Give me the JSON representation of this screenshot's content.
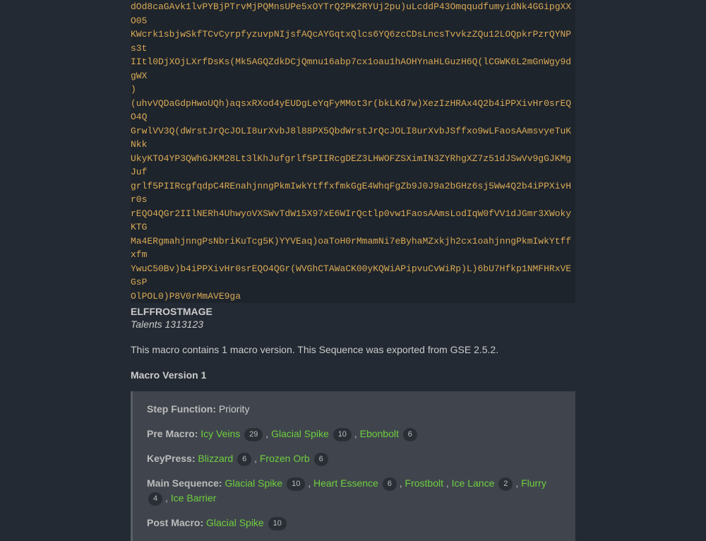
{
  "encoded_lines": [
    "dOd8caGAvk1lvPYBjPTrvMjPQMnsUPe5xOYTrQ2PK2RYUj2pu)uLcddP43OmqqudfumyidNk4GGipgXXO05",
    "KWcrk1sbjwSkfTCvCyrpfyzuvpNIjsfAQcAYGqtxQlcs6YQ6zcCDsLncsTvvkzZQu12LOQpkrPzrQYNPs3t",
    "IItl0DjXOjLXrfDsKs(Mk5AGQZdkDCjQmnu16abp7cx1oau1hAOHYnaHLGuzH6Q(lCGWK6L2mGnWgy9dgWX",
    ")",
    "(uhvVQDaGdpHwoUQh)aqsxRXod4yEUDgLeYqFyMMot3r(bkLKd7w)XezIzHRAx4Q2b4iPPXivHr0srEQO4Q",
    "GrwlVV3Q(dWrstJrQcJOLI8urXvbJ8l88PX5QbdWrstJrQcJOLI8urXvbJSffxo9wLFaosAAmsvyeTuKNkk",
    "UkyKTO4YP3QWhGJKM28Lt3lKhJufgrlf5PIIRcgDEZ3LHWOFZSXimIN3ZYRhgXZ7z51dJSwVv9gGJKMgJuf",
    "grlf5PIIRcgfqdpC4REnahjnngPkmIwkYtffxfmkGgE4WhqFgZb9J0J9a2bGHz6sj5Ww4Q2b4iPPXivHr0s",
    "rEQO4QGr2IIlNERh4UhwyoVXSWvTdW15X97xE6WIrQctlp0vw1FaosAAmsLodIqW0fVV1dJGmr3XWokyKTG",
    "Ma4ERgmahjnngPsNbriKuTcg5K)YYVEaq)oaToH0rMmamNi7eByhaMZxkjh2cx1oahjnngPkmIwkYtffxfm",
    "YwuC50Bv)b4iPPXivHr0srEQO4QGr(WVGhCTAWaCK00yKQWiAPipvuCvWiRp)L)6bU7Hfkp1NMFHRxVEGsP",
    "OlPOL0)P8V0rMmAVE9ga"
  ],
  "title": "ELFFROSTMAGE",
  "talents_label": "Talents",
  "talents_value": "1313123",
  "description": "This macro contains 1 macro version. This Sequence was exported from GSE 2.5.2.",
  "version_header": "Macro Version 1",
  "macro": {
    "step_function": {
      "label": "Step Function:",
      "value": "Priority"
    },
    "pre_macro": {
      "label": "Pre Macro:",
      "items": [
        {
          "name": "Icy Veins",
          "badge": "29"
        },
        {
          "name": "Glacial Spike",
          "badge": "10"
        },
        {
          "name": "Ebonbolt",
          "badge": "6"
        }
      ]
    },
    "key_press": {
      "label": "KeyPress:",
      "items": [
        {
          "name": "Blizzard",
          "badge": "6"
        },
        {
          "name": "Frozen Orb",
          "badge": "6"
        }
      ]
    },
    "main_sequence": {
      "label": "Main Sequence:",
      "items": [
        {
          "name": "Glacial Spike",
          "badge": "10"
        },
        {
          "name": "Heart Essence",
          "badge": "6"
        },
        {
          "name": "Frostbolt",
          "badge": null
        },
        {
          "name": "Ice Lance",
          "badge": "2"
        },
        {
          "name": "Flurry",
          "badge": "4"
        },
        {
          "name": "Ice Barrier",
          "badge": null
        }
      ]
    },
    "post_macro": {
      "label": "Post Macro:",
      "items": [
        {
          "name": "Glacial Spike",
          "badge": "10"
        }
      ]
    }
  }
}
